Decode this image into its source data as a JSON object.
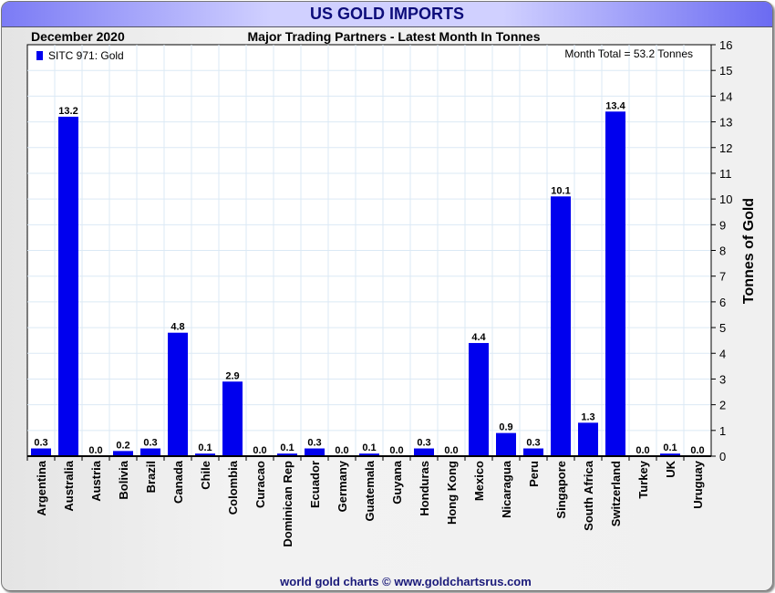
{
  "title": "US GOLD IMPORTS",
  "date": "December 2020",
  "footer": "world gold charts © www.goldchartsrus.com",
  "colors": {
    "bar": "#0000ee",
    "grid": "#dbe9f5",
    "title": "#0c0c7a"
  },
  "chart_data": {
    "type": "bar",
    "title": "Major Trading Partners - Latest Month In Tonnes",
    "legend": "SITC 971: Gold",
    "legend_position": "top-left",
    "annotation": "Month Total = 53.2 Tonnes",
    "ylabel": "Tonnes of Gold",
    "xlabel": "",
    "ylim": [
      0,
      16
    ],
    "yticks": [
      "0",
      "1",
      "2",
      "3",
      "4",
      "5",
      "6",
      "7",
      "8",
      "9",
      "10",
      "11",
      "12",
      "13",
      "14",
      "15",
      "16"
    ],
    "grid": true,
    "categories": [
      "Argentina",
      "Australia",
      "Austria",
      "Bolivia",
      "Brazil",
      "Canada",
      "Chile",
      "Colombia",
      "Curacao",
      "Dominican Rep",
      "Ecuador",
      "Germany",
      "Guatemala",
      "Guyana",
      "Honduras",
      "Hong Kong",
      "Mexico",
      "Nicaragua",
      "Peru",
      "Singapore",
      "South Africa",
      "Switzerland",
      "Turkey",
      "UK",
      "Uruguay"
    ],
    "values": [
      0.3,
      13.2,
      0.0,
      0.2,
      0.3,
      4.8,
      0.1,
      2.9,
      0.0,
      0.1,
      0.3,
      0.0,
      0.1,
      0.0,
      0.3,
      0.0,
      4.4,
      0.9,
      0.3,
      10.1,
      1.3,
      13.4,
      0.0,
      0.1,
      0.0
    ],
    "labels": [
      "0.3",
      "13.2",
      "0.0",
      "0.2",
      "0.3",
      "4.8",
      "0.1",
      "2.9",
      "0.0",
      "0.1",
      "0.3",
      "0.0",
      "0.1",
      "0.0",
      "0.3",
      "0.0",
      "4.4",
      "0.9",
      "0.3",
      "10.1",
      "1.3",
      "13.4",
      "0.0",
      "0.1",
      "0.0"
    ]
  }
}
